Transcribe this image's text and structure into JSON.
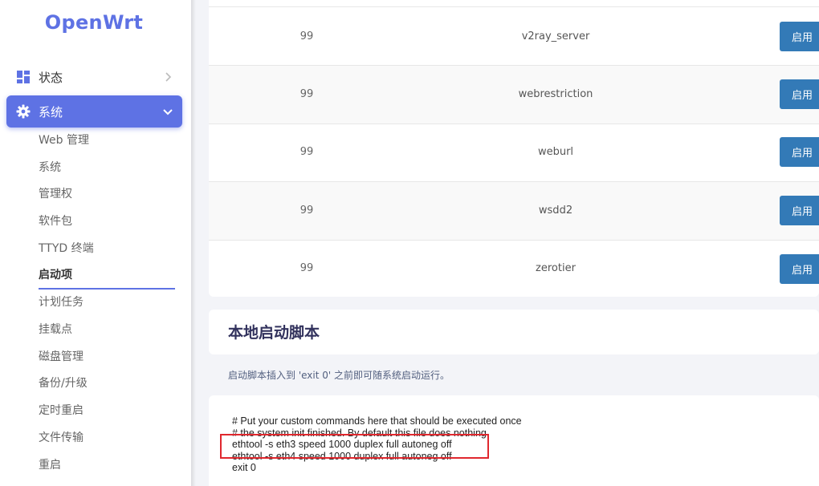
{
  "logo": "OpenWrt",
  "sidebar": {
    "menu": [
      {
        "label": "状态",
        "icon": "dashboard-icon"
      },
      {
        "label": "系统",
        "icon": "gear-icon"
      }
    ],
    "submenu": [
      "Web 管理",
      "系统",
      "管理权",
      "软件包",
      "TTYD 终端",
      "启动项",
      "计划任务",
      "挂载点",
      "磁盘管理",
      "备份/升级",
      "定时重启",
      "文件传输",
      "重启"
    ],
    "active_submenu": "启动项"
  },
  "startup_table": {
    "rows": [
      {
        "priority": "99",
        "name": "v2ray_server",
        "action": "启用"
      },
      {
        "priority": "99",
        "name": "webrestriction",
        "action": "启用"
      },
      {
        "priority": "99",
        "name": "weburl",
        "action": "启用"
      },
      {
        "priority": "99",
        "name": "wsdd2",
        "action": "启用"
      },
      {
        "priority": "99",
        "name": "zerotier",
        "action": "启用"
      }
    ]
  },
  "local_startup": {
    "title": "本地启动脚本",
    "description": "启动脚本插入到 'exit 0' 之前即可随系统启动运行。",
    "script_lines": [
      "# Put your custom commands here that should be executed once",
      "# the system init finished. By default this file does nothing.",
      "ethtool -s eth3 speed 1000 duplex full autoneg off",
      "ethtool -s eth4 speed 1000 duplex full autoneg off",
      "exit 0"
    ]
  },
  "colors": {
    "accent": "#5e72e4",
    "button": "#337ab7",
    "highlight": "#e0282e"
  }
}
